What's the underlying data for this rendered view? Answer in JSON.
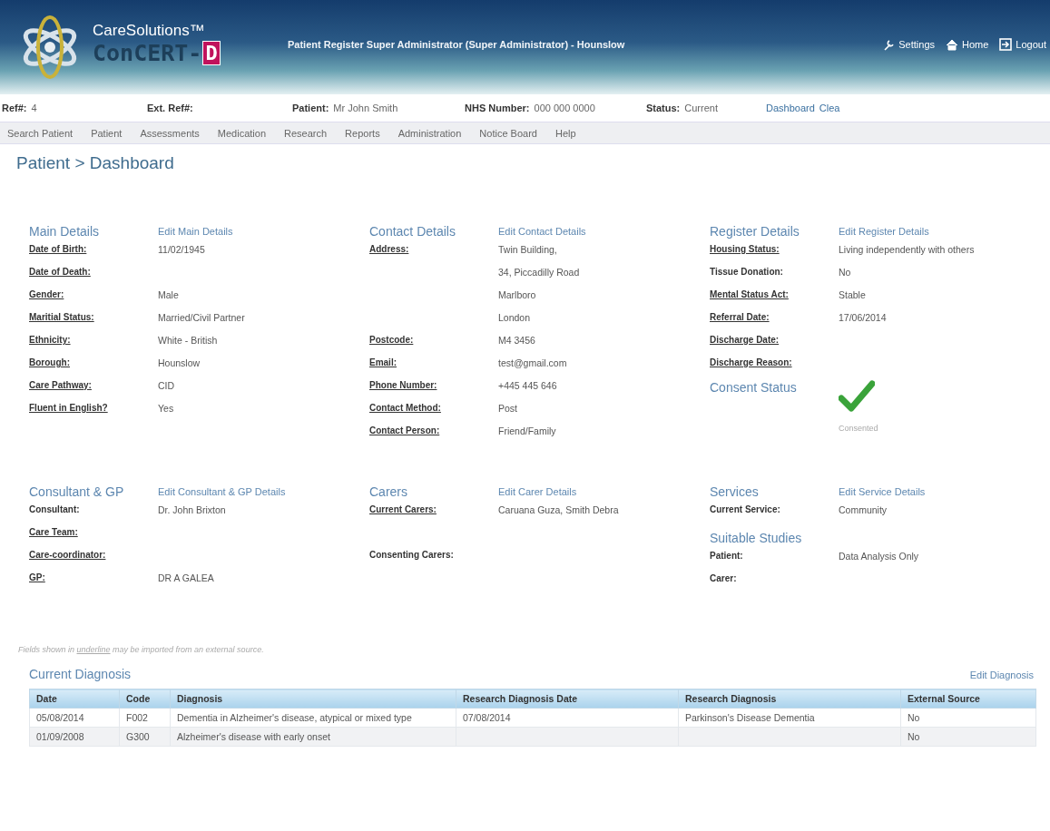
{
  "header": {
    "brand": "CareSolutions™",
    "product": "ConCERT-",
    "product_mark": "D",
    "user": "Patient Register Super Administrator (Super Administrator) - Hounslow",
    "links": [
      {
        "kind": "settings",
        "label": "Settings"
      },
      {
        "kind": "home",
        "label": "Home"
      },
      {
        "kind": "logout",
        "label": "Logout"
      }
    ]
  },
  "patient_bar": {
    "fields": [
      {
        "label": "Ref#:",
        "value": "4"
      },
      {
        "label": "Ext. Ref#:"
      },
      {
        "label": "Patient:",
        "value": "Mr John Smith"
      },
      {
        "label": "NHS Number:",
        "value": "000 000 0000"
      },
      {
        "label": "Status:",
        "value": "Current"
      }
    ],
    "links": [
      "Dashboard",
      "Clea"
    ]
  },
  "nav": [
    "Search Patient",
    "Patient",
    "Assessments",
    "Medication",
    "Research",
    "Reports",
    "Administration",
    "Notice Board",
    "Help"
  ],
  "breadcrumb": "Patient > Dashboard",
  "section_rows": [
    [
      {
        "title": "Main Details",
        "edit": "Edit Main Details",
        "rows": [
          {
            "label": "Date of Birth:",
            "underlined": true,
            "value": "11/02/1945"
          },
          {
            "label": "Date of Death:",
            "underlined": true
          },
          {
            "label": "Gender:",
            "underlined": true,
            "value": "Male"
          },
          {
            "label": "Maritial Status:",
            "underlined": true,
            "value": "Married/Civil Partner"
          },
          {
            "label": "Ethnicity:",
            "underlined": true,
            "value": "White - British"
          },
          {
            "label": "Borough:",
            "underlined": true,
            "value": "Hounslow"
          },
          {
            "label": "Care Pathway:",
            "underlined": true,
            "value": "CID"
          },
          {
            "label": "Fluent in English?",
            "underlined": true,
            "value": "Yes"
          }
        ]
      },
      {
        "title": "Contact Details",
        "edit": "Edit Contact Details",
        "rows": [
          {
            "label": "Address:",
            "underlined": true,
            "value": "Twin Building,"
          },
          {
            "value": "34, Piccadilly Road"
          },
          {
            "value": "Marlboro"
          },
          {
            "value": "London"
          },
          {
            "label": "Postcode:",
            "underlined": true,
            "value": "M4 3456"
          },
          {
            "label": "Email:",
            "underlined": true,
            "value": "test@gmail.com"
          },
          {
            "label": "Phone Number:",
            "underlined": true,
            "value": "+445 445 646"
          },
          {
            "label": "Contact Method:",
            "underlined": true,
            "value": "Post"
          },
          {
            "label": "Contact Person:",
            "underlined": true,
            "value": "Friend/Family"
          }
        ]
      },
      {
        "title": "Register Details",
        "edit": "Edit Register Details",
        "rows": [
          {
            "label": "Housing Status:",
            "underlined": true,
            "value": "Living independently with others"
          },
          {
            "label": "Tissue Donation:",
            "underlined": false,
            "value": "No"
          },
          {
            "label": "Mental Status Act:",
            "underlined": true,
            "value": "Stable"
          },
          {
            "label": "Referral Date:",
            "underlined": true,
            "value": "17/06/2014"
          },
          {
            "label": "Discharge Date:",
            "underlined": true
          },
          {
            "label": "Discharge Reason:",
            "underlined": true
          }
        ],
        "consent": {
          "title": "Consent Status",
          "consented": true,
          "caption": "Consented"
        }
      }
    ],
    [
      {
        "title": "Consultant & GP",
        "edit": "Edit Consultant & GP Details",
        "rows": [
          {
            "label": "Consultant:",
            "underlined": false,
            "value": "Dr. John Brixton"
          },
          {
            "label": "Care Team:",
            "underlined": true
          },
          {
            "label": "Care-coordinator:",
            "underlined": true
          },
          {
            "label": "GP:",
            "underlined": true,
            "value": "DR A GALEA"
          }
        ]
      },
      {
        "title": "Carers",
        "edit": "Edit Carer Details",
        "rows": [
          {
            "label": "Current Carers:",
            "underlined": true,
            "value": "Caruana Guza, Smith Debra"
          },
          {},
          {
            "label": "Consenting Carers:",
            "underlined": false
          }
        ]
      },
      {
        "title": "Services",
        "edit": "Edit Service Details",
        "rows": [
          {
            "label": "Current Service:",
            "underlined": false,
            "value": "Community"
          }
        ],
        "subsection": {
          "title": "Suitable Studies",
          "rows": [
            {
              "label": "Patient:",
              "underlined": false,
              "value": "Data Analysis Only"
            },
            {
              "label": "Carer:",
              "underlined": false
            }
          ]
        }
      }
    ]
  ],
  "footnote": {
    "before": "Fields shown in ",
    "marked": "underline",
    "after": " may be imported from an external source."
  },
  "diagnosis": {
    "title": "Current Diagnosis",
    "edit": "Edit Diagnosis",
    "columns": [
      "Date",
      "Code",
      "Diagnosis",
      "Research Diagnosis Date",
      "Research Diagnosis",
      "External Source"
    ],
    "rows": [
      [
        "05/08/2014",
        "F002",
        "Dementia in Alzheimer's disease, atypical or mixed type",
        "07/08/2014",
        "Parkinson's Disease Dementia",
        "No"
      ],
      [
        "01/09/2008",
        "G300",
        "Alzheimer's disease with early onset",
        "",
        "",
        "No"
      ]
    ]
  }
}
